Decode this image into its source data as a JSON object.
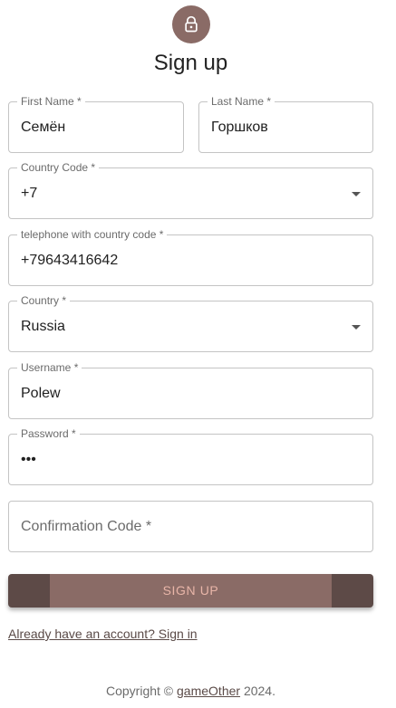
{
  "header": {
    "title": "Sign up",
    "icon": "lock-icon"
  },
  "form": {
    "first_name": {
      "label": "First Name *",
      "value": "Семён"
    },
    "last_name": {
      "label": "Last Name *",
      "value": "Горшков"
    },
    "country_code": {
      "label": "Country Code *",
      "value": "+7"
    },
    "telephone": {
      "label": "telephone with country code *",
      "value": "+79643416642"
    },
    "country": {
      "label": "Country *",
      "value": "Russia"
    },
    "username": {
      "label": "Username *",
      "value": "Polew"
    },
    "password": {
      "label": "Password *",
      "value": "•••"
    },
    "confirmation_code": {
      "placeholder": "Confirmation Code *"
    }
  },
  "actions": {
    "sign_up": "SIGN UP",
    "sign_in_link": "Already have an account? Sign in"
  },
  "footer": {
    "prefix": "Copyright © ",
    "brand": "gameOther",
    "suffix": " 2024."
  },
  "colors": {
    "accent": "#8a6b66",
    "button_dark": "#5d4a47",
    "button_text": "#e8b5a8"
  }
}
